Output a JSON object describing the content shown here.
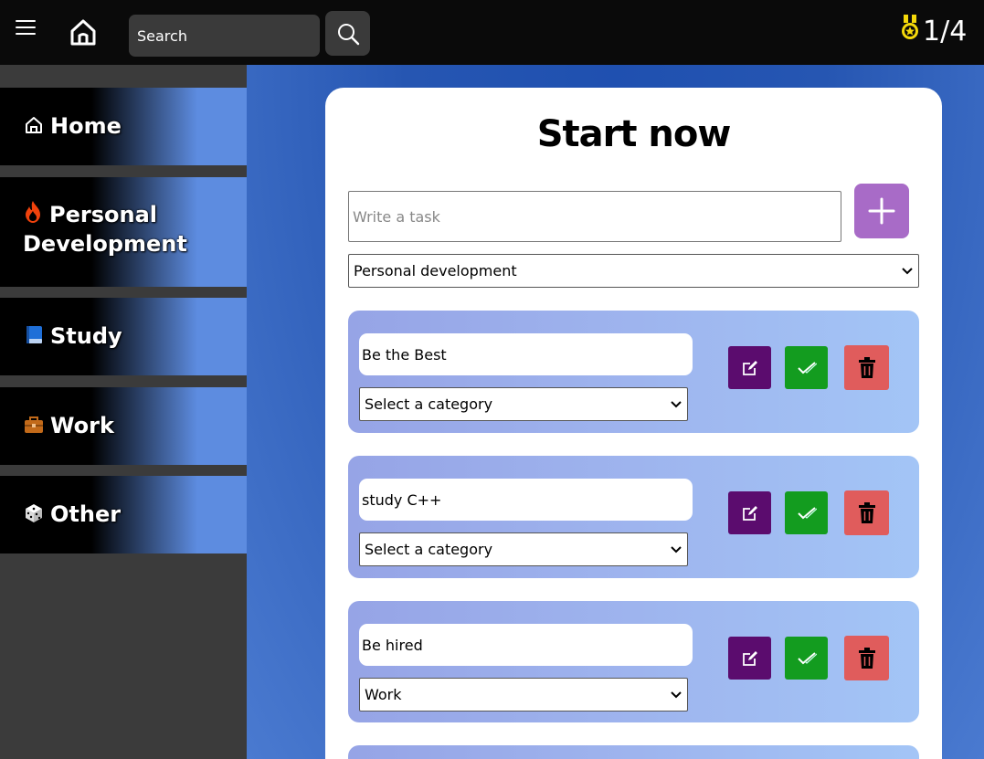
{
  "header": {
    "search_placeholder": "Search",
    "score": "1/4",
    "icons": [
      "menu-icon",
      "home-icon",
      "search-icon",
      "medal-icon"
    ],
    "medal_color": "#f5d90a"
  },
  "sidebar": {
    "items": [
      {
        "label": "Home",
        "icon": "home-icon"
      },
      {
        "label": "Personal",
        "label2": "Development",
        "icon": "fire-icon"
      },
      {
        "label": "Study",
        "icon": "book-icon"
      },
      {
        "label": "Work",
        "icon": "briefcase-icon"
      },
      {
        "label": "Other",
        "icon": "dice-icon"
      }
    ]
  },
  "main": {
    "title": "Start now",
    "task_placeholder": "Write a task",
    "category_selected": "Personal development",
    "add_color": "#a86bc7",
    "tasks": [
      {
        "name": "Be the Best",
        "category": "Select a category"
      },
      {
        "name": "study C++",
        "category": "Select a category"
      },
      {
        "name": "Be hired",
        "category": "Work"
      }
    ],
    "action_colors": {
      "edit": "#5b0c6e",
      "done": "#139c1f",
      "delete": "#e05c5c"
    }
  }
}
